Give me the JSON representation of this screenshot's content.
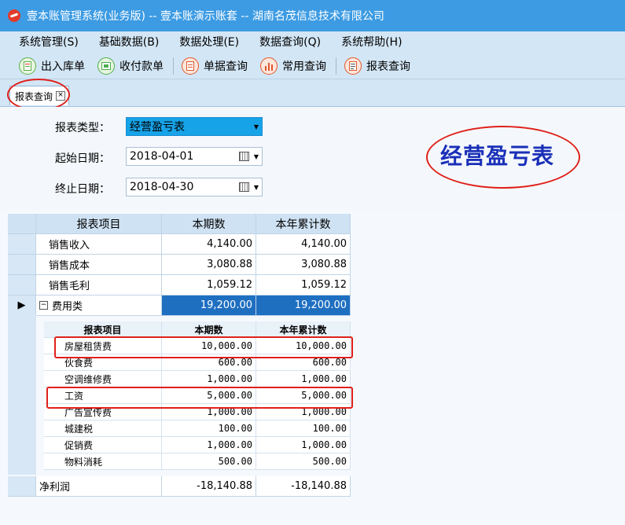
{
  "window": {
    "title": "壹本账管理系统(业务版) -- 壹本账演示账套 -- 湖南名茂信息技术有限公司"
  },
  "menu": [
    "系统管理(S)",
    "基础数据(B)",
    "数据处理(E)",
    "数据查询(Q)",
    "系统帮助(H)"
  ],
  "toolbar": [
    {
      "label": "出入库单",
      "icon": "stock-doc-icon",
      "color": "#5bb04a"
    },
    {
      "label": "收付款单",
      "icon": "payment-icon",
      "color": "#4caf50"
    },
    {
      "label": "单据查询",
      "icon": "document-search-icon",
      "color": "#e2572b"
    },
    {
      "label": "常用查询",
      "icon": "bar-chart-icon",
      "color": "#e2572b"
    },
    {
      "label": "报表查询",
      "icon": "report-icon",
      "color": "#e2572b"
    }
  ],
  "tab": {
    "label": "报表查询",
    "close": "×"
  },
  "form": {
    "report_type_label": "报表类型：",
    "report_type_value": "经营盈亏表",
    "start_label": "起始日期：",
    "start_value": "2018-04-01",
    "end_label": "终止日期：",
    "end_value": "2018-04-30"
  },
  "annotation": "经营盈亏表",
  "grid": {
    "headers": [
      "报表项目",
      "本期数",
      "本年累计数"
    ],
    "rows": [
      {
        "item": "销售收入",
        "current": "4,140.00",
        "ytd": "4,140.00"
      },
      {
        "item": "销售成本",
        "current": "3,080.88",
        "ytd": "3,080.88"
      },
      {
        "item": "销售毛利",
        "current": "1,059.12",
        "ytd": "1,059.12"
      },
      {
        "item": "费用类",
        "current": "19,200.00",
        "ytd": "19,200.00"
      }
    ],
    "expander": "−",
    "detail_headers": [
      "报表项目",
      "本期数",
      "本年累计数"
    ],
    "details": [
      {
        "item": "房屋租赁费",
        "current": "10,000.00",
        "ytd": "10,000.00"
      },
      {
        "item": "伙食费",
        "current": "600.00",
        "ytd": "600.00"
      },
      {
        "item": "空调维修费",
        "current": "1,000.00",
        "ytd": "1,000.00"
      },
      {
        "item": "工资",
        "current": "5,000.00",
        "ytd": "5,000.00"
      },
      {
        "item": "广告宣传费",
        "current": "1,000.00",
        "ytd": "1,000.00"
      },
      {
        "item": "城建税",
        "current": "100.00",
        "ytd": "100.00"
      },
      {
        "item": "促销费",
        "current": "1,000.00",
        "ytd": "1,000.00"
      },
      {
        "item": "物料消耗",
        "current": "500.00",
        "ytd": "500.00"
      }
    ],
    "footer": {
      "item": "净利润",
      "current": "-18,140.88",
      "ytd": "-18,140.88"
    }
  }
}
